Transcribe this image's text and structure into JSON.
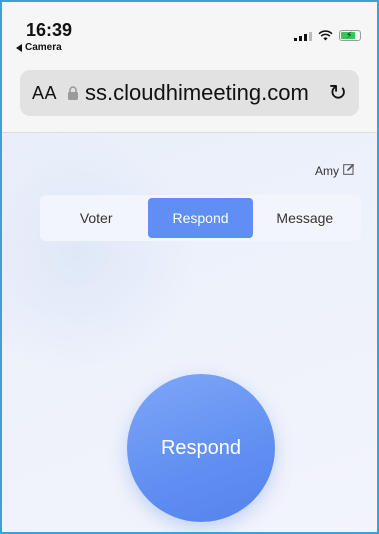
{
  "status_bar": {
    "time": "16:39",
    "back_app": "Camera",
    "battery_color": "#34c759"
  },
  "browser": {
    "aa_label": "AA",
    "url": "ss.cloudhimeeting.com",
    "reload_icon": "reload-icon",
    "lock_icon": "lock-icon"
  },
  "page": {
    "user_name": "Amy",
    "edit_icon": "edit-icon",
    "tabs": [
      {
        "label": "Voter"
      },
      {
        "label": "Respond"
      },
      {
        "label": "Message"
      }
    ],
    "active_tab": "Respond",
    "respond_button": "Respond",
    "accent_color": "#5f8ff2"
  }
}
